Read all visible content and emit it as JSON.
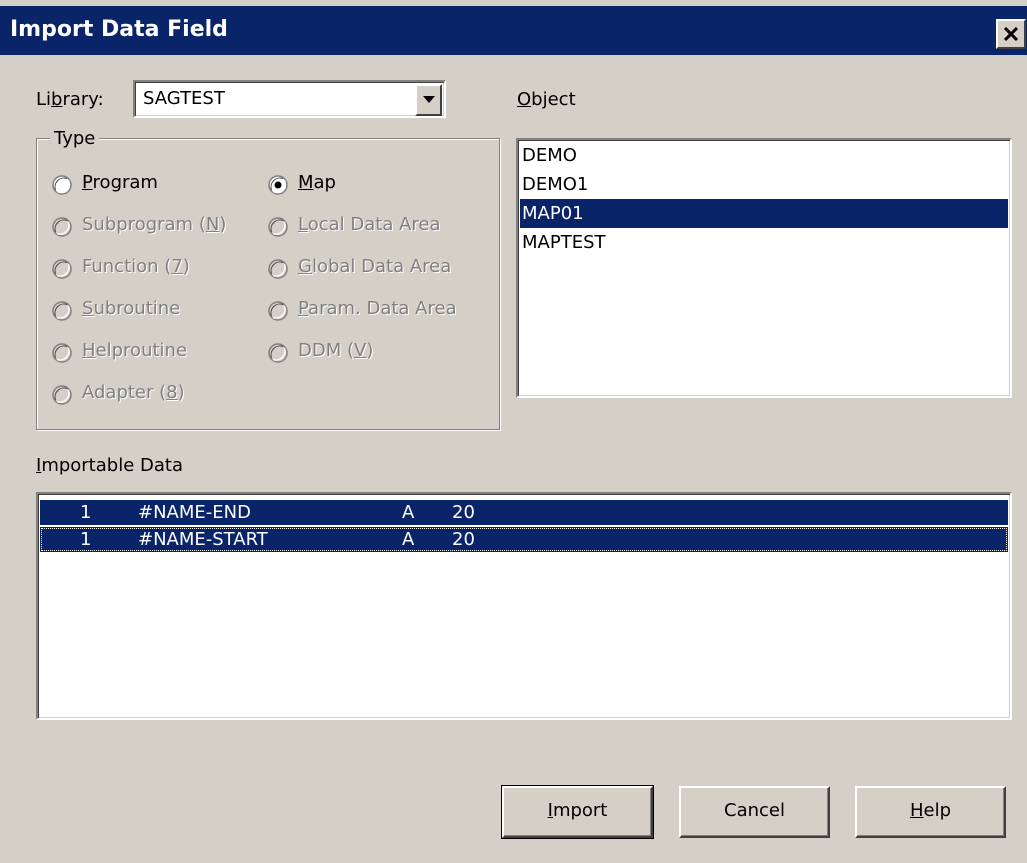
{
  "window": {
    "title": "Import Data Field"
  },
  "library": {
    "label_pre": "Li",
    "label_u": "b",
    "label_post": "rary:",
    "value": "SAGTEST"
  },
  "object": {
    "label_u": "O",
    "label_post": "bject",
    "items": [
      "DEMO",
      "DEMO1",
      "MAP01",
      "MAPTEST"
    ],
    "selected": "MAP01"
  },
  "type_group": {
    "label": "Type",
    "options": [
      {
        "pre": "",
        "u": "P",
        "post": "rogram",
        "checked": false,
        "enabled": true
      },
      {
        "pre": "",
        "u": "M",
        "post": "ap",
        "checked": true,
        "enabled": true
      },
      {
        "pre": "Subprogram (",
        "u": "N",
        "post": ")",
        "checked": false,
        "enabled": false
      },
      {
        "pre": "",
        "u": "L",
        "post": "ocal Data Area",
        "checked": false,
        "enabled": false
      },
      {
        "pre": "Function (",
        "u": "7",
        "post": ")",
        "checked": false,
        "enabled": false
      },
      {
        "pre": "",
        "u": "G",
        "post": "lobal Data Area",
        "checked": false,
        "enabled": false
      },
      {
        "pre": "",
        "u": "S",
        "post": "ubroutine",
        "checked": false,
        "enabled": false
      },
      {
        "pre": "",
        "u": "P",
        "post": "aram. Data Area",
        "checked": false,
        "enabled": false
      },
      {
        "pre": "",
        "u": "H",
        "post": "elproutine",
        "checked": false,
        "enabled": false
      },
      {
        "pre": "DDM (",
        "u": "V",
        "post": ")",
        "checked": false,
        "enabled": false
      },
      {
        "pre": "Adapter (",
        "u": "8",
        "post": ")",
        "checked": false,
        "enabled": false
      }
    ]
  },
  "importable": {
    "label_u": "I",
    "label_post": "mportable Data",
    "rows": [
      {
        "level": "1",
        "name": "#NAME-END",
        "format": "A",
        "length": "20"
      },
      {
        "level": "1",
        "name": "#NAME-START",
        "format": "A",
        "length": "20"
      }
    ]
  },
  "buttons": {
    "import": {
      "u": "I",
      "post": "mport"
    },
    "cancel": {
      "label": "Cancel"
    },
    "help": {
      "u": "H",
      "post": "elp"
    }
  },
  "colors": {
    "selection": "#0a246a",
    "dialog_bg": "#d4d0c8"
  }
}
